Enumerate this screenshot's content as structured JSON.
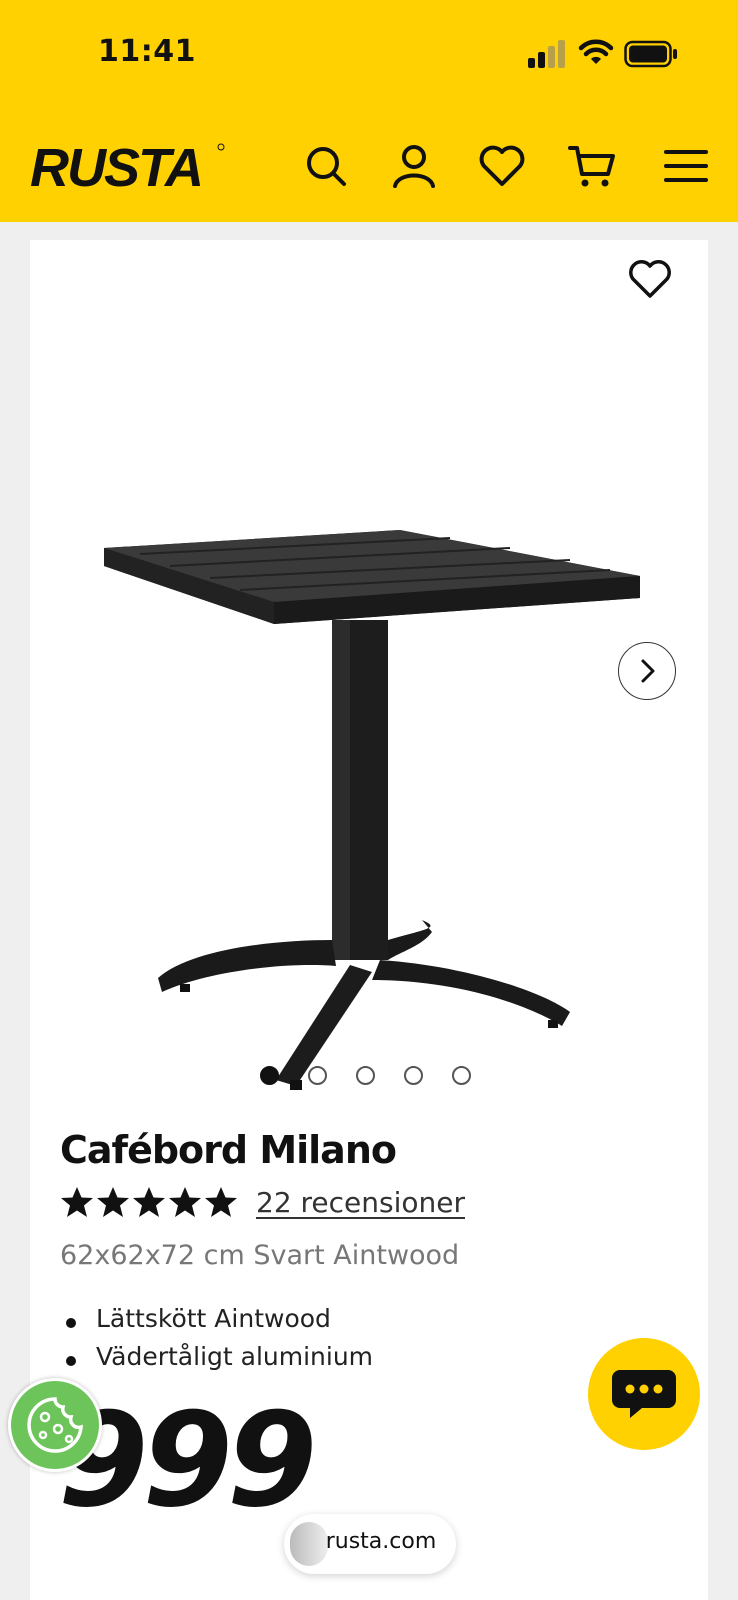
{
  "status_bar": {
    "time": "11:41"
  },
  "header": {
    "logo_text": "RUSTA",
    "icons": [
      "search-icon",
      "user-icon",
      "heart-icon",
      "cart-icon",
      "menu-icon"
    ],
    "background_color": "#ffd100"
  },
  "gallery": {
    "image_count": 5,
    "active_index": 0
  },
  "product": {
    "title": "Cafébord Milano",
    "rating_stars": 5,
    "reviews_label": "22 recensioner",
    "subtitle": "62x62x72 cm Svart Aintwood",
    "features": [
      "Lättskött Aintwood",
      "Vädertåligt aluminium"
    ],
    "price": "999"
  },
  "browser": {
    "url": "rusta.com"
  },
  "colors": {
    "accent": "#ffd100",
    "cookie": "#6dc45a"
  }
}
